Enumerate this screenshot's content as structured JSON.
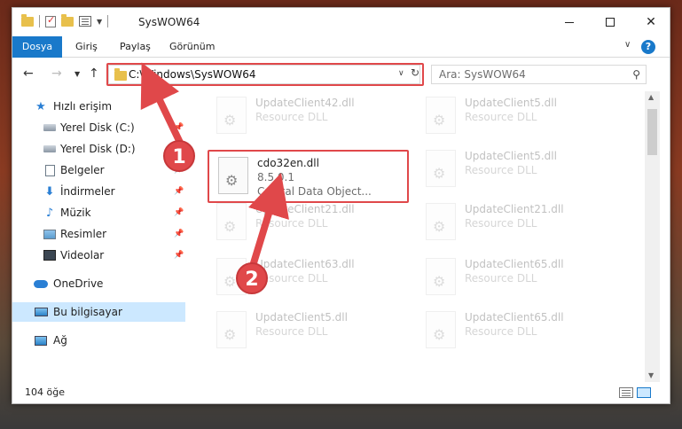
{
  "window": {
    "title": "SysWOW64"
  },
  "ribbon": {
    "tabs": [
      "Dosya",
      "Giriş",
      "Paylaş",
      "Görünüm"
    ],
    "help": "?"
  },
  "address": {
    "path": "C:\\Windows\\SysWOW64"
  },
  "search": {
    "placeholder": "Ara: SysWOW64"
  },
  "navpane": {
    "items": [
      {
        "label": "Hızlı erişim",
        "icon": "star-icon",
        "pinned": false
      },
      {
        "label": "Yerel Disk (C:)",
        "icon": "drive-icon",
        "pinned": true
      },
      {
        "label": "Yerel Disk (D:)",
        "icon": "drive-icon",
        "pinned": false
      },
      {
        "label": "Belgeler",
        "icon": "documents-icon",
        "pinned": true
      },
      {
        "label": "İndirmeler",
        "icon": "download-icon",
        "pinned": true
      },
      {
        "label": "Müzik",
        "icon": "music-icon",
        "pinned": true
      },
      {
        "label": "Resimler",
        "icon": "pictures-icon",
        "pinned": true
      },
      {
        "label": "Videolar",
        "icon": "videos-icon",
        "pinned": true
      },
      {
        "label": "OneDrive",
        "icon": "cloud-icon",
        "pinned": false
      },
      {
        "label": "Bu bilgisayar",
        "icon": "computer-icon",
        "pinned": false,
        "selected": true
      },
      {
        "label": "Ağ",
        "icon": "network-icon",
        "pinned": false
      }
    ]
  },
  "files": {
    "highlighted": {
      "name": "cdo32en.dll",
      "version": "8.5.0.1",
      "description": "Crystal Data Object..."
    },
    "background": [
      {
        "name": "UpdateClient42.dll",
        "type": "Resource DLL"
      },
      {
        "name": "UpdateClient5.dll",
        "type": "Resource DLL"
      },
      {
        "name": "UpdateClient5.dll",
        "type": "Resource DLL"
      },
      {
        "name": "UpdateClient21.dll",
        "type": "Resource DLL"
      },
      {
        "name": "UpdateClient21.dll",
        "type": "Resource DLL"
      },
      {
        "name": "UpdateClient63.dll",
        "type": "Resource DLL"
      },
      {
        "name": "UpdateClient65.dll",
        "type": "Resource DLL"
      },
      {
        "name": "UpdateClient5.dll",
        "type": "Resource DLL"
      },
      {
        "name": "UpdateClient65.dll",
        "type": "Resource DLL"
      }
    ]
  },
  "status": {
    "count": "104 öğe"
  },
  "annotations": {
    "badge1": "1",
    "badge2": "2",
    "color": "#e0484a"
  }
}
